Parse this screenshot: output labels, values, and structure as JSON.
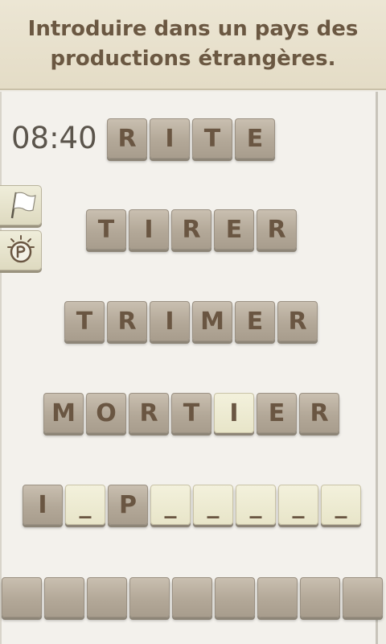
{
  "clue": {
    "line1": "Introduire dans un pays des",
    "line2": "productions étrangères."
  },
  "timer": "08:40",
  "words": [
    [
      "R",
      "I",
      "T",
      "E"
    ],
    [
      "T",
      "I",
      "R",
      "E",
      "R"
    ],
    [
      "T",
      "R",
      "I",
      "M",
      "E",
      "R"
    ],
    [
      "M",
      "O",
      "R",
      "T",
      "I",
      "E",
      "R"
    ]
  ],
  "answer": [
    "I",
    "_",
    "P",
    "_",
    "_",
    "_",
    "_",
    "_"
  ],
  "answer_revealed": [
    true,
    false,
    true,
    false,
    false,
    false,
    false,
    false
  ],
  "highlight_tile": {
    "row": 3,
    "index": 4
  },
  "tray_count": 9,
  "icons": {
    "flag": "flag-icon",
    "hint": "lightbulb-icon"
  }
}
